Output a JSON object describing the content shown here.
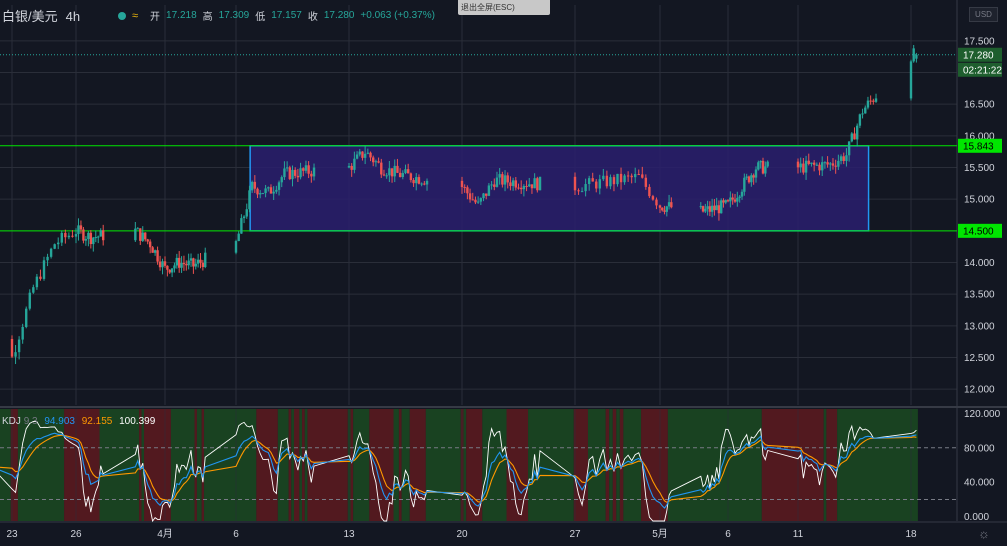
{
  "header": {
    "symbol": "白银/美元",
    "timeframe": "4h",
    "open_label": "开",
    "open_value": "17.218",
    "high_label": "高",
    "high_value": "17.309",
    "low_label": "低",
    "low_value": "17.157",
    "close_label": "收",
    "close_value": "17.280",
    "change": "+0.063 (+0.37%)",
    "exit_fullscreen_label": "退出全屏(ESC)",
    "currency_button": "USD"
  },
  "indicator": {
    "name": "KDJ",
    "params": "9 3",
    "k_value": "94.903",
    "d_value": "92.155",
    "j_value": "100.399"
  },
  "colors": {
    "background": "#131722",
    "up": "#26a69a",
    "down": "#ef5350",
    "green_line": "#00e600",
    "box_fill": "#2a1f6e",
    "box_border": "#2196f3",
    "k": "#2196f3",
    "d": "#ff9800",
    "j": "#ffffff",
    "zone_green": "#1b4721",
    "zone_red": "#5a1a1f"
  },
  "chart_data": [
    {
      "type": "candlestick",
      "title": "白银/美元 4h",
      "y_axis": {
        "range": [
          11.75,
          17.75
        ],
        "ticks": [
          "12.000",
          "12.500",
          "13.000",
          "13.500",
          "14.000",
          "14.500",
          "15.000",
          "15.500",
          "16.000",
          "16.500",
          "17.000",
          "17.500"
        ]
      },
      "x_axis": {
        "ticks": [
          "23",
          "26",
          "4月",
          "6",
          "13",
          "20",
          "27",
          "5月",
          "6",
          "11",
          "18"
        ]
      },
      "grid": true,
      "price_labels": [
        {
          "text": "17.280",
          "value": 17.28,
          "role": "last-price"
        },
        {
          "text": "02:21:22",
          "role": "countdown"
        },
        {
          "text": "15.843",
          "value": 15.843,
          "role": "horizontal-line"
        },
        {
          "text": "14.500",
          "value": 14.5,
          "role": "horizontal-line"
        }
      ],
      "horizontal_lines": [
        15.843,
        14.5
      ],
      "range_box": {
        "top": 15.843,
        "bottom": 14.5,
        "from": "4/7",
        "to": "5/15"
      },
      "close_path": [
        {
          "x": "3/20",
          "y": 12.6
        },
        {
          "x": "3/21",
          "y": 12.9
        },
        {
          "x": "3/23",
          "y": 12.5
        },
        {
          "x": "3/24",
          "y": 13.6
        },
        {
          "x": "3/25",
          "y": 14.3
        },
        {
          "x": "3/26",
          "y": 14.5
        },
        {
          "x": "3/27",
          "y": 14.4
        },
        {
          "x": "3/30",
          "y": 14.5
        },
        {
          "x": "3/31",
          "y": 14.3
        },
        {
          "x": "4/1",
          "y": 13.9
        },
        {
          "x": "4/2",
          "y": 14.0
        },
        {
          "x": "4/3",
          "y": 13.95
        },
        {
          "x": "4/6",
          "y": 14.3
        },
        {
          "x": "4/7",
          "y": 15.2
        },
        {
          "x": "4/8",
          "y": 15.1
        },
        {
          "x": "4/9",
          "y": 15.4
        },
        {
          "x": "4/13",
          "y": 15.5
        },
        {
          "x": "4/14",
          "y": 15.75
        },
        {
          "x": "4/15",
          "y": 15.5
        },
        {
          "x": "4/16",
          "y": 15.4
        },
        {
          "x": "4/20",
          "y": 15.2
        },
        {
          "x": "4/21",
          "y": 14.9
        },
        {
          "x": "4/22",
          "y": 15.3
        },
        {
          "x": "4/27",
          "y": 15.2
        },
        {
          "x": "4/30",
          "y": 15.35
        },
        {
          "x": "5/1",
          "y": 14.9
        },
        {
          "x": "5/4",
          "y": 14.8
        },
        {
          "x": "5/6",
          "y": 14.9
        },
        {
          "x": "5/7",
          "y": 15.2
        },
        {
          "x": "5/8",
          "y": 15.5
        },
        {
          "x": "5/11",
          "y": 15.5
        },
        {
          "x": "5/13",
          "y": 15.55
        },
        {
          "x": "5/14",
          "y": 15.7
        },
        {
          "x": "5/15",
          "y": 16.4
        },
        {
          "x": "5/18",
          "y": 17.28
        }
      ]
    },
    {
      "type": "line",
      "title": "KDJ 9 3",
      "y_axis": {
        "range": [
          -5,
          125
        ],
        "ticks": [
          "0.000",
          "40.000",
          "80.000",
          "120.000"
        ]
      },
      "reference_lines": [
        20,
        80
      ],
      "series": [
        {
          "name": "K",
          "last": 94.903
        },
        {
          "name": "D",
          "last": 92.155
        },
        {
          "name": "J",
          "last": 100.399
        }
      ]
    }
  ]
}
